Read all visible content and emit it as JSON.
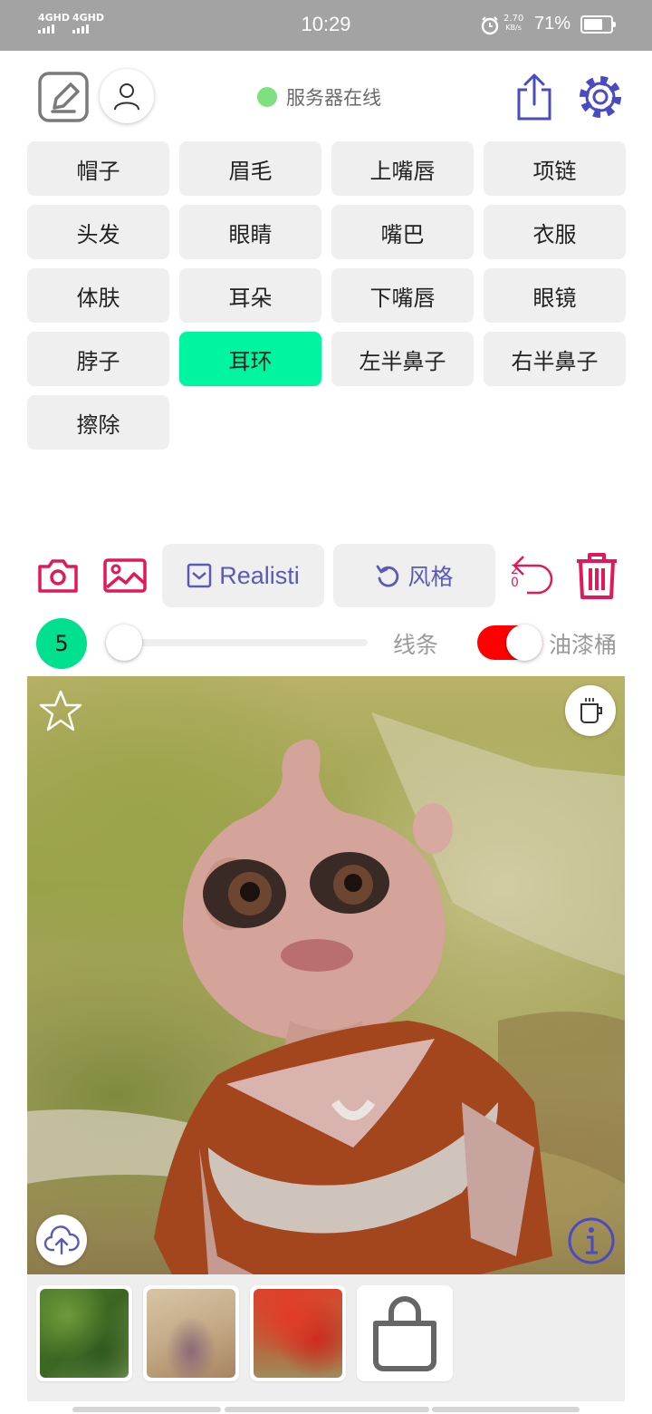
{
  "status_bar": {
    "network1": "4GHD",
    "network2": "4GHD",
    "time": "10:29",
    "speed_value": "2.70",
    "speed_unit": "KB/s",
    "battery_percent": "71%",
    "battery_level": 0.71
  },
  "header": {
    "server_status": "服务器在线",
    "server_status_color": "#7ee07e",
    "icons": [
      "edit-icon",
      "user-icon",
      "share-icon",
      "settings-icon"
    ]
  },
  "labels": [
    {
      "text": "帽子",
      "active": false
    },
    {
      "text": "眉毛",
      "active": false
    },
    {
      "text": "上嘴唇",
      "active": false
    },
    {
      "text": "项链",
      "active": false
    },
    {
      "text": "头发",
      "active": false
    },
    {
      "text": "眼睛",
      "active": false
    },
    {
      "text": "嘴巴",
      "active": false
    },
    {
      "text": "衣服",
      "active": false
    },
    {
      "text": "体肤",
      "active": false
    },
    {
      "text": "耳朵",
      "active": false
    },
    {
      "text": "下嘴唇",
      "active": false
    },
    {
      "text": "眼镜",
      "active": false
    },
    {
      "text": "脖子",
      "active": false
    },
    {
      "text": "耳环",
      "active": true
    },
    {
      "text": "左半鼻子",
      "active": false
    },
    {
      "text": "右半鼻子",
      "active": false
    },
    {
      "text": "擦除",
      "active": false
    }
  ],
  "tools": {
    "mode_label": "Realisti",
    "style_label": "风格",
    "undo_count_top": "2",
    "undo_count_bottom": "0",
    "accent_color": "#e0195a",
    "pill_text_color": "#5a5ab8"
  },
  "brush": {
    "size": "5",
    "slider_value": 0.03,
    "lines_label": "线条",
    "bucket_label": "油漆桶",
    "bucket_enabled": true
  },
  "canvas": {
    "icons": [
      "star-icon",
      "coffee-icon",
      "upload-icon",
      "info-icon"
    ]
  },
  "thumbnails": [
    "thumbnail-green-foliage",
    "thumbnail-beige-texture",
    "thumbnail-red-leaves",
    "shopping-bag-icon"
  ]
}
